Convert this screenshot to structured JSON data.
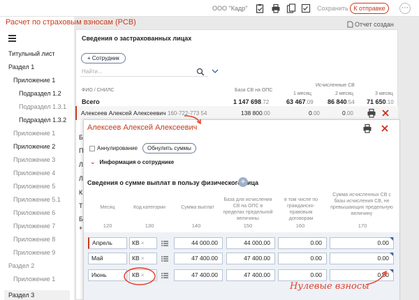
{
  "topbar": {
    "org": "ООО \"Кадр\"",
    "save_label": "Сохранить",
    "send_label": "К отправке",
    "more_label": "⋯"
  },
  "app": {
    "title": "Расчет по страховым взносам (РСВ)",
    "status": "Отчет создан"
  },
  "nav": [
    {
      "label": "Титульный лист",
      "level": 1,
      "tone": "dark"
    },
    {
      "label": "Раздел 1",
      "level": 1,
      "tone": "dark"
    },
    {
      "label": "Приложение 1",
      "level": 2,
      "tone": "dark"
    },
    {
      "label": "Подраздел 1.2",
      "level": 3,
      "tone": "dark"
    },
    {
      "label": "Подраздел 1.3.1",
      "level": 3,
      "tone": "gray"
    },
    {
      "label": "Подраздел 1.3.2",
      "level": 3,
      "tone": "dark"
    },
    {
      "label": "Приложение 1",
      "level": 2,
      "tone": "gray"
    },
    {
      "label": "Приложение 2",
      "level": 2,
      "tone": "dark"
    },
    {
      "label": "Приложение 3",
      "level": 2,
      "tone": "gray"
    },
    {
      "label": "Приложение 4",
      "level": 2,
      "tone": "gray"
    },
    {
      "label": "Приложение 5",
      "level": 2,
      "tone": "gray"
    },
    {
      "label": "Приложение 5.1",
      "level": 2,
      "tone": "gray"
    },
    {
      "label": "Приложение 6",
      "level": 2,
      "tone": "gray"
    },
    {
      "label": "Приложение 7",
      "level": 2,
      "tone": "gray"
    },
    {
      "label": "Приложение 8",
      "level": 2,
      "tone": "gray"
    },
    {
      "label": "Приложение 9",
      "level": 2,
      "tone": "gray"
    },
    {
      "label": "Раздел 2",
      "level": 1,
      "tone": "gray"
    },
    {
      "label": "Приложение 1",
      "level": 2,
      "tone": "gray"
    },
    {
      "label": "Раздел 3",
      "level": 1,
      "tone": "active"
    }
  ],
  "insured": {
    "title": "Сведения о застрахованных лицах",
    "add_button": "+ Сотрудник",
    "search_placeholder": "Найти...",
    "col_name": "ФИО / СНИЛС",
    "col_base": "База СВ на ОПС",
    "col_calc": "Исчисленные СВ",
    "col_m1": "1 месяц",
    "col_m2": "2 месяц",
    "col_m3": "3 месяц",
    "total_label": "Всего",
    "total_base_int": "1 147 698",
    "total_base_dec": ".72",
    "total_m1_int": "63 467",
    "total_m1_dec": ".09",
    "total_m2_int": "86 840",
    "total_m2_dec": ".54",
    "total_m3_int": "71 650",
    "total_m3_dec": ".10",
    "row_name": "Алексеев Алексей Алексеевич",
    "row_snils": "160-722-773 54",
    "row_base_int": "138 800",
    "row_base_dec": ".00",
    "row_m1_int": "0",
    "row_m1_dec": ".00",
    "row_m2_int": "0",
    "row_m2_dec": ".00"
  },
  "peek_letters": [
    "Б",
    "П",
    "Л",
    "Л",
    "К",
    "Т",
    "Б",
    "+"
  ],
  "detail": {
    "name": "Алексеев Алексей Алексеевич",
    "cancel_label": "Аннулирование",
    "zero_button": "Обнулить суммы",
    "info_toggle": "Информация о сотруднике",
    "section_title": "Сведения о сумме выплат в пользу физического лица",
    "headers": {
      "month": "Месяц",
      "code": "Код категории",
      "sum": "Сумма выплат",
      "base": "База для исчисления СВ на ОПС в пределах предельной величины",
      "gph": "в том числе по гражданско-правовым договорам",
      "over": "Сумма исчисленных СВ с базы исчисления СВ, не превышающих предельную величину"
    },
    "codes": {
      "month": "120",
      "code": "130",
      "sum": "140",
      "base": "150",
      "gph": "160",
      "over": "170"
    },
    "rows": [
      {
        "month": "Апрель",
        "code": "КВ",
        "sum": "44 000.00",
        "base": "44 000.00",
        "gph": "0.00",
        "over": "0.00"
      },
      {
        "month": "Май",
        "code": "КВ",
        "sum": "47 400.00",
        "base": "47 400.00",
        "gph": "0.00",
        "over": "0.00"
      },
      {
        "month": "Июнь",
        "code": "КВ",
        "sum": "47 400.00",
        "base": "47 400.00",
        "gph": "0.00",
        "over": "0.00"
      }
    ]
  },
  "annotation": "Нулевые взносы",
  "colors": {
    "accent": "#c83a1b",
    "annotation": "#e0402a",
    "field_border": "#b8c4d6"
  }
}
